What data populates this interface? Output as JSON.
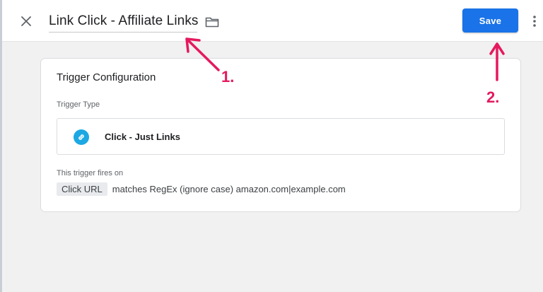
{
  "header": {
    "title": "Link Click - Affiliate Links",
    "save_label": "Save",
    "close_icon": "close-icon",
    "folder_icon": "folder-icon",
    "more_icon": "more-vert-icon"
  },
  "trigger_configuration": {
    "heading": "Trigger Configuration",
    "type_label": "Trigger Type",
    "type_name": "Click - Just Links",
    "type_icon": "link-icon",
    "fires_on_label": "This trigger fires on",
    "condition": {
      "variable": "Click URL",
      "rule": "matches RegEx (ignore case) amazon.com|example.com"
    }
  },
  "annotations": {
    "step_1": "1.",
    "step_2": "2."
  },
  "colors": {
    "accent": "#1a73e8",
    "link_icon": "#1ca8e3",
    "annotation": "#e5195e"
  }
}
